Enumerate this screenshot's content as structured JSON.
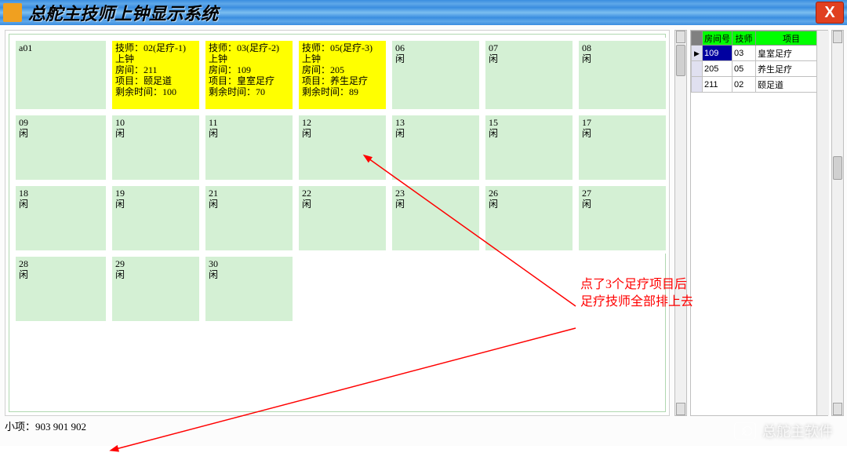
{
  "title": "总舵主技师上钟显示系统",
  "close_label": "X",
  "grid": {
    "rows": [
      [
        {
          "lines": [
            "",
            "a01"
          ],
          "yellow": false
        },
        {
          "lines": [
            "技师：02(足疗-1)",
            " 上钟",
            "房间：211",
            "项目：颐足道",
            "剩余时间：100"
          ],
          "yellow": true
        },
        {
          "lines": [
            "技师：03(足疗-2)",
            " 上钟",
            "房间：109",
            "项目：皇室足疗",
            "剩余时间：70"
          ],
          "yellow": true
        },
        {
          "lines": [
            "技师：05(足疗-3)",
            " 上钟",
            "房间：205",
            "项目：养生足疗",
            "剩余时间：89"
          ],
          "yellow": true
        },
        {
          "lines": [
            "06",
            "闲"
          ],
          "yellow": false
        },
        {
          "lines": [
            "07",
            "闲"
          ],
          "yellow": false
        }
      ],
      [
        {
          "lines": [
            "08",
            "闲"
          ]
        },
        {
          "lines": [
            "09",
            "闲"
          ]
        },
        {
          "lines": [
            "10",
            "闲"
          ]
        },
        {
          "lines": [
            "11",
            "闲"
          ]
        },
        {
          "lines": [
            "12",
            "闲"
          ]
        },
        {
          "lines": [
            "13",
            "闲"
          ]
        }
      ],
      [
        {
          "lines": [
            "15",
            "闲"
          ]
        },
        {
          "lines": [
            "17",
            "闲"
          ]
        },
        {
          "lines": [
            "18",
            "闲"
          ]
        },
        {
          "lines": [
            "19",
            "闲"
          ]
        },
        {
          "lines": [
            "21",
            "闲"
          ]
        },
        {
          "lines": [
            "22",
            "闲"
          ]
        }
      ],
      [
        {
          "lines": [
            "23",
            "闲"
          ]
        },
        {
          "lines": [
            "26",
            "闲"
          ]
        },
        {
          "lines": [
            "27",
            "闲"
          ]
        },
        {
          "lines": [
            "28",
            "闲"
          ]
        },
        {
          "lines": [
            "29",
            "闲"
          ]
        },
        {
          "lines": [
            "30",
            "闲"
          ]
        }
      ]
    ]
  },
  "side": {
    "headers": [
      "房间号",
      "技师",
      "项目"
    ],
    "rows": [
      {
        "room": "109",
        "tech": "03",
        "proj": "皇室足疗",
        "active": true
      },
      {
        "room": "205",
        "tech": "05",
        "proj": "养生足疗",
        "active": false
      },
      {
        "room": "211",
        "tech": "02",
        "proj": "颐足道",
        "active": false
      }
    ]
  },
  "annotation": {
    "line1": "点了3个足疗项目后",
    "line2": "足疗技师全部排上去"
  },
  "footer": "小项：903 901 902",
  "watermark": "总舵主软件"
}
